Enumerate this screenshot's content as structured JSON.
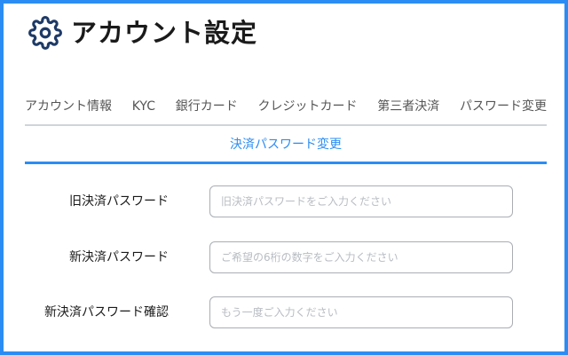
{
  "header": {
    "title": "アカウント設定",
    "icon": "gear-icon"
  },
  "tabs": [
    {
      "label": "アカウント情報"
    },
    {
      "label": "KYC"
    },
    {
      "label": "銀行カード"
    },
    {
      "label": "クレジットカード"
    },
    {
      "label": "第三者決済"
    },
    {
      "label": "パスワード変更"
    }
  ],
  "subtab": {
    "label": "決済パスワード変更",
    "active": true
  },
  "form": {
    "old_password": {
      "label": "旧決済パスワード",
      "placeholder": "旧決済パスワードをご入力ください",
      "value": ""
    },
    "new_password": {
      "label": "新決済パスワード",
      "placeholder": "ご希望の6桁の数字をご入力ください",
      "value": ""
    },
    "confirm_password": {
      "label": "新決済パスワード確認",
      "placeholder": "もう一度ご入力ください",
      "value": ""
    }
  },
  "colors": {
    "accent": "#2b8cf4",
    "text": "#1a1a1a",
    "tab_text": "#555555",
    "placeholder": "#b8bcc2",
    "input_border": "#a9adb3"
  }
}
